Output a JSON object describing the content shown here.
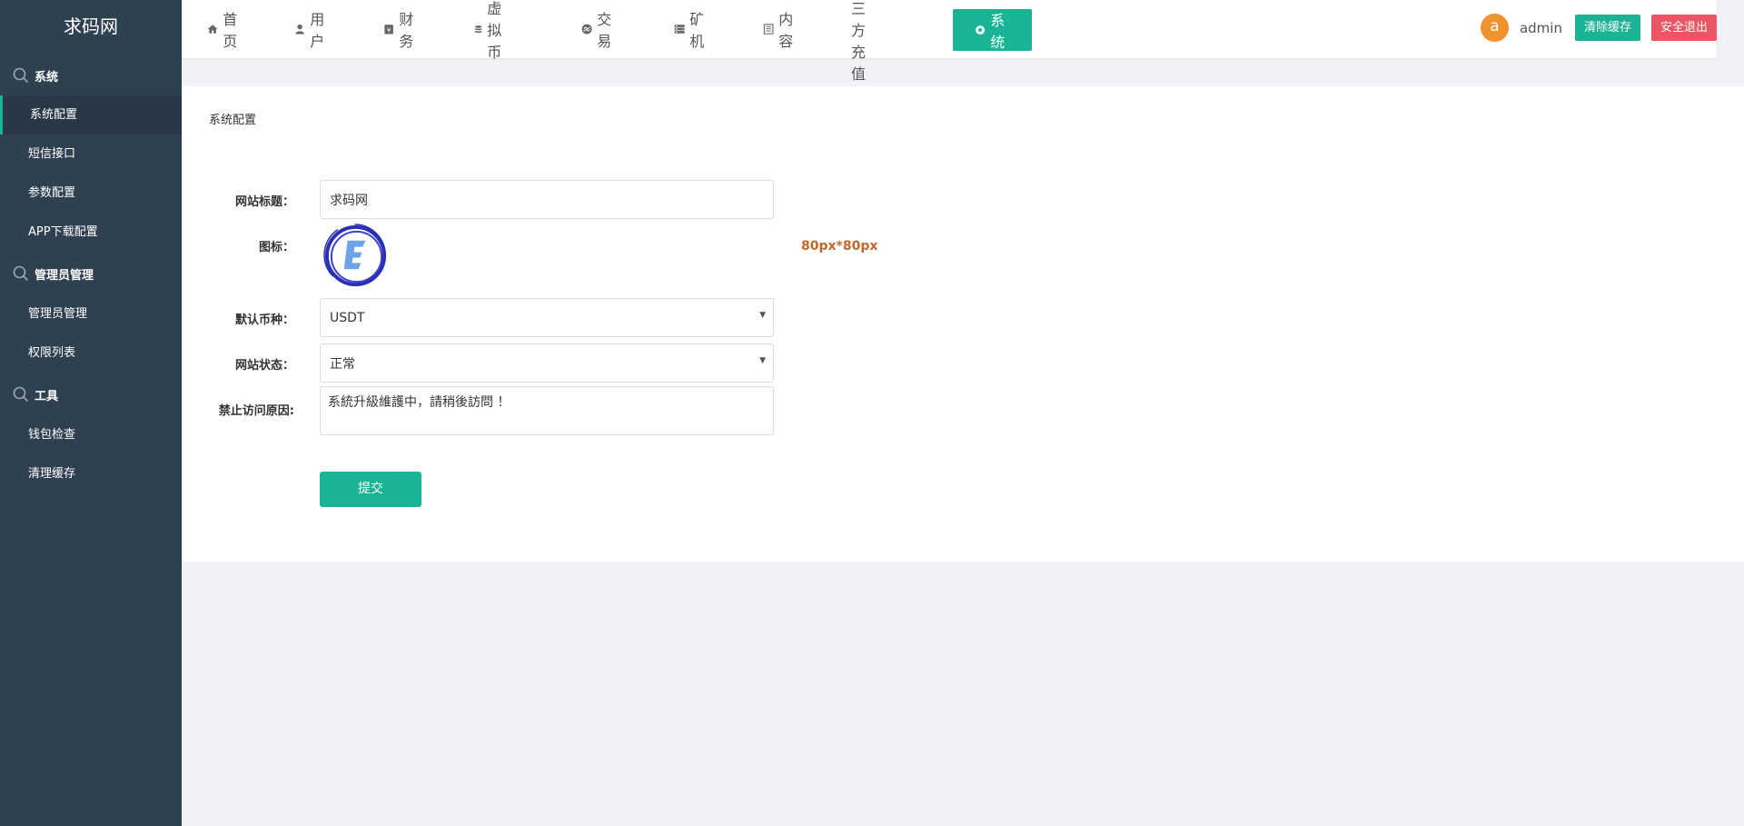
{
  "sidebar": {
    "logo": "求码网",
    "groups": [
      {
        "title": "系统",
        "items": [
          "系统配置",
          "短信接口",
          "参数配置",
          "APP下载配置"
        ]
      },
      {
        "title": "管理员管理",
        "items": [
          "管理员管理",
          "权限列表"
        ]
      },
      {
        "title": "工具",
        "items": [
          "钱包检查",
          "清理缓存"
        ]
      }
    ]
  },
  "topnav": {
    "items": [
      "首页",
      "用户",
      "财务",
      "虚拟币",
      "交易",
      "矿机",
      "内容",
      "第三方充值",
      "系统"
    ],
    "active": "系统",
    "user": {
      "avatar_letter": "a",
      "name": "admin"
    },
    "clear_cache": "清除缓存",
    "logout": "安全退出"
  },
  "main": {
    "title": "系统配置",
    "fields": {
      "site_title_label": "网站标题：",
      "site_title_value": "求码网",
      "icon_label": "图标：",
      "icon_hint": "80px*80px",
      "currency_label": "默认币种：",
      "currency_value": "USDT",
      "status_label": "网站状态：",
      "status_value": "正常",
      "reason_label": "禁止访问原因:",
      "reason_value": "系統升級維護中，請稍後訪問 ！"
    },
    "submit": "提交"
  },
  "colors": {
    "sidebar": "#2f4050",
    "accent": "#1ab394",
    "danger": "#ed5565",
    "avatar": "#f0922d",
    "hint": "#c0692a"
  }
}
